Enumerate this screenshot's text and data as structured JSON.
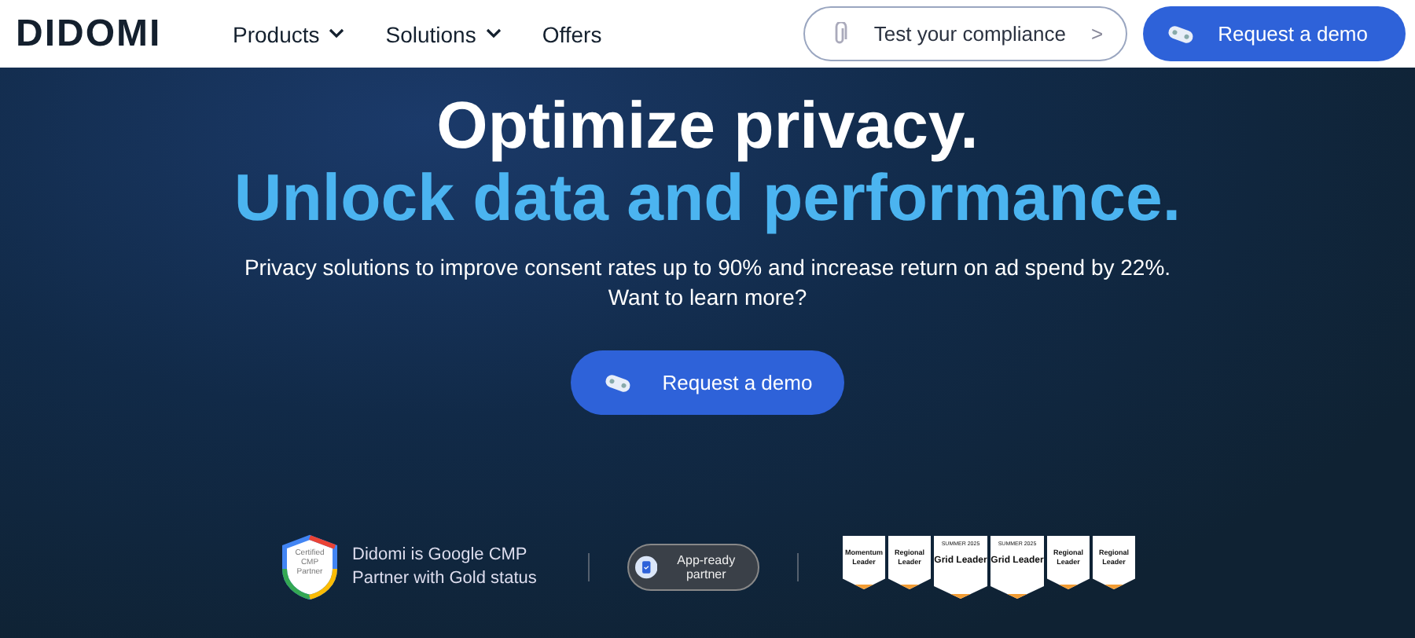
{
  "header": {
    "logo": "DIDOMI",
    "nav": [
      {
        "label": "Products",
        "dropdown": true
      },
      {
        "label": "Solutions",
        "dropdown": true
      },
      {
        "label": "Offers",
        "dropdown": false
      }
    ],
    "compliance_button": {
      "label": "Test your compliance",
      "arrow": ">"
    },
    "demo_button": {
      "label": "Request a demo"
    }
  },
  "hero": {
    "title": "Optimize privacy.",
    "subtitle": "Unlock data and performance.",
    "description": "Privacy solutions to improve consent rates up to 90% and increase return on ad spend by 22%.",
    "question": "Want to learn more?",
    "cta": "Request a demo"
  },
  "trust": {
    "google_badge": "Certified CMP Partner",
    "google_text": "Didomi is Google CMP Partner with Gold status",
    "app_badge": "App-ready partner",
    "g2_badges": [
      {
        "title": "Momentum Leader",
        "kind": "small"
      },
      {
        "title": "Regional Leader",
        "kind": "small"
      },
      {
        "season": "SUMMER 2025",
        "title": "Grid Leader",
        "kind": "large"
      },
      {
        "season": "SUMMER 2025",
        "title": "Grid Leader",
        "kind": "large"
      },
      {
        "title": "Regional Leader",
        "kind": "small"
      },
      {
        "title": "Regional Leader",
        "kind": "small"
      }
    ]
  }
}
